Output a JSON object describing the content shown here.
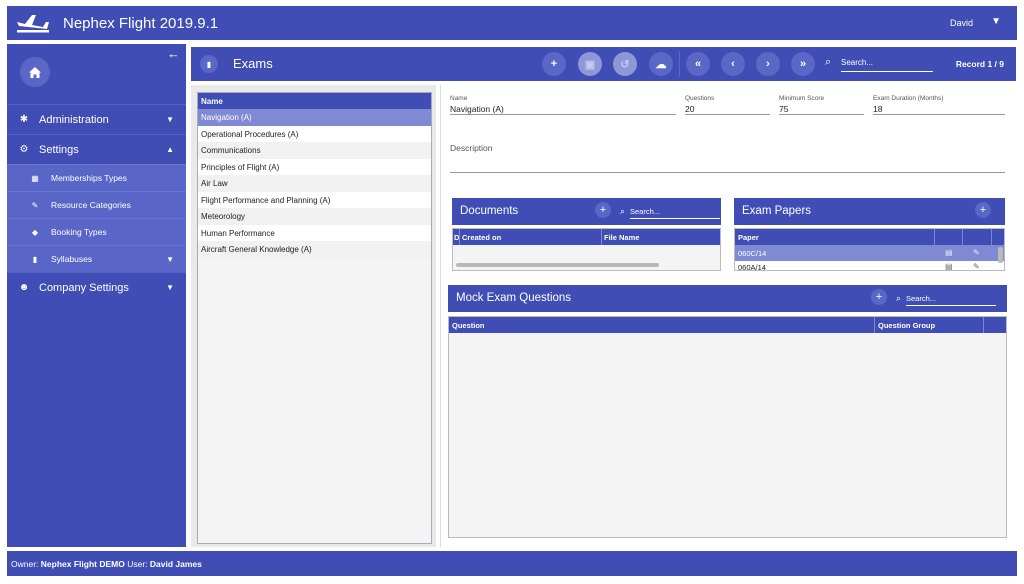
{
  "app": {
    "title": "Nephex Flight 2019.9.1",
    "user": "David"
  },
  "sidebar": {
    "items": [
      {
        "label": "Administration",
        "icon": "gear-icon",
        "expanded": false
      },
      {
        "label": "Settings",
        "icon": "gears-icon",
        "expanded": true,
        "children": [
          {
            "label": "Memberships Types",
            "icon": "calendar-icon"
          },
          {
            "label": "Resource Categories",
            "icon": "wrench-icon"
          },
          {
            "label": "Booking Types",
            "icon": "tags-icon"
          },
          {
            "label": "Syllabuses",
            "icon": "book-icon"
          }
        ]
      },
      {
        "label": "Company Settings",
        "icon": "users-icon",
        "expanded": false
      }
    ]
  },
  "header": {
    "title": "Exams",
    "search_placeholder": "Search...",
    "record": "Record 1 / 9"
  },
  "exam_list": {
    "column": "Name",
    "rows": [
      "Navigation (A)",
      "Operational Procedures (A)",
      "Communications",
      "Principles of Flight (A)",
      "Air Law",
      "Flight Performance and Planning (A)",
      "Meteorology",
      "Human Performance",
      "Aircraft General Knowledge (A)"
    ],
    "selected_index": 0
  },
  "form": {
    "name_label": "Name",
    "name_value": "Navigation (A)",
    "questions_label": "Questions",
    "questions_value": "20",
    "min_score_label": "Minimum Score",
    "min_score_value": "75",
    "duration_label": "Exam Duration (Months)",
    "duration_value": "18",
    "description_label": "Description"
  },
  "documents": {
    "title": "Documents",
    "search_placeholder": "Search...",
    "col_d": "D",
    "col_created": "Created on",
    "col_file": "File Name"
  },
  "exam_papers": {
    "title": "Exam Papers",
    "col_paper": "Paper",
    "rows": [
      "060C/14",
      "060A/14"
    ]
  },
  "mock_questions": {
    "title": "Mock Exam Questions",
    "search_placeholder": "Search...",
    "col_question": "Question",
    "col_group": "Question Group"
  },
  "footer": {
    "owner_label": "Owner:",
    "owner_value": "Nephex Flight DEMO",
    "user_label": "User:",
    "user_value": "David James"
  },
  "colors": {
    "primary": "#3f4db5",
    "selected": "#7f89d4",
    "submenu": "#5966c8"
  }
}
